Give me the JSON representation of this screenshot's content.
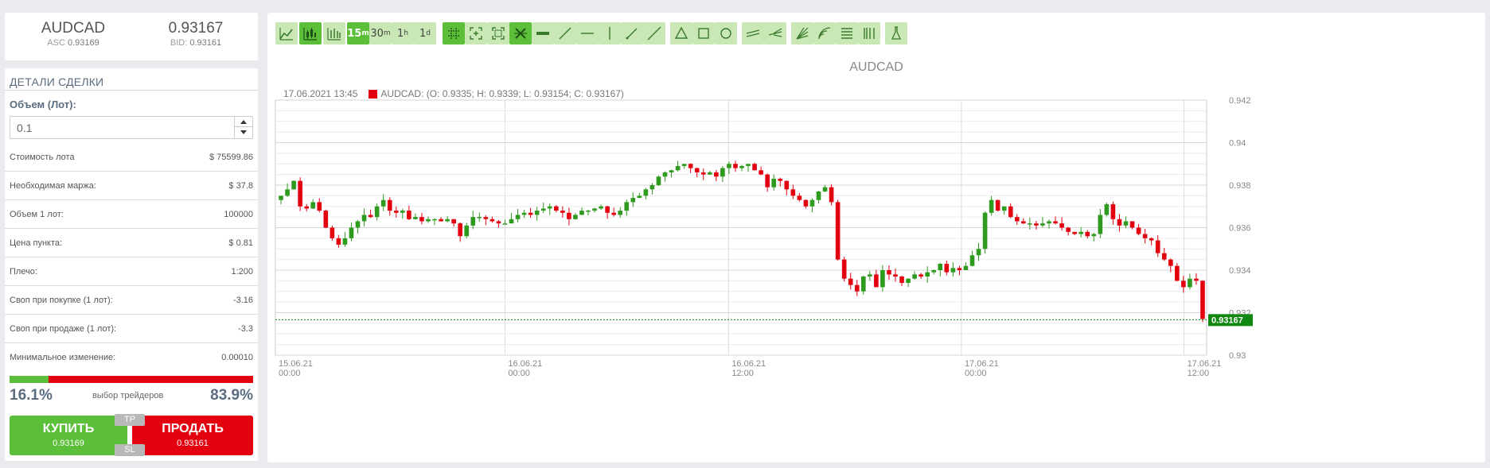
{
  "quote": {
    "symbol": "AUDCAD",
    "ask_label": "ASC",
    "ask": "0.93169",
    "price": "0.93167",
    "bid_label": "BID:",
    "bid": "0.93161"
  },
  "deal": {
    "title": "ДЕТАЛИ СДЕЛКИ",
    "volume_label": "Объем (Лот):",
    "volume_value": "0.1",
    "rows": [
      {
        "label": "Стоимость лота",
        "value": "$ 75599.86"
      },
      {
        "label": "Необходимая маржа:",
        "value": "$ 37.8"
      },
      {
        "label": "Объем 1 лот:",
        "value": "100000"
      },
      {
        "label": "Цена пункта:",
        "value": "$ 0.81"
      },
      {
        "label": "Плечо:",
        "value": "1:200"
      },
      {
        "label": "Своп при покупке (1 лот):",
        "value": "-3.16"
      },
      {
        "label": "Своп при продаже (1 лот):",
        "value": "-3.3"
      },
      {
        "label": "Минимальное изменение:",
        "value": "0.00010"
      }
    ],
    "sentiment": {
      "buy_percent": "16.1%",
      "sell_percent": "83.9%",
      "label": "выбор трейдеров",
      "buy_fraction": 0.161
    },
    "buy": {
      "label": "КУПИТЬ",
      "price": "0.93169"
    },
    "sell": {
      "label": "ПРОДАТЬ",
      "price": "0.93161"
    },
    "tp_label": "TP",
    "sl_label": "SL"
  },
  "toolbar": {
    "timeframes": [
      "15",
      "30",
      "1",
      "1"
    ],
    "timeframe_suffixes": [
      "m",
      "m",
      "h",
      "d"
    ],
    "active_timeframe": "15m"
  },
  "chart": {
    "title": "AUDCAD",
    "ohlc_time": "17.06.2021 13:45",
    "ohlc_text": "AUDCAD: (O: 0.9335; H: 0.9339; L: 0.93154; C: 0.93167)",
    "current_price_label": "0.93167"
  },
  "colors": {
    "up": "#2e9a1e",
    "down": "#e3000f",
    "accent": "#5cbf3a",
    "price_tag": "#118811"
  },
  "chart_data": {
    "type": "candlestick",
    "title": "AUDCAD",
    "ylim": [
      0.93,
      0.942
    ],
    "y_ticks": [
      "0.942",
      "0.94",
      "0.938",
      "0.936",
      "0.934",
      "0.932",
      "0.93"
    ],
    "x_tick_labels": [
      {
        "date": "15.06.21",
        "time": "00:00"
      },
      {
        "date": "16.06.21",
        "time": "00:00"
      },
      {
        "date": "16.06.21",
        "time": "12:00"
      },
      {
        "date": "17.06.21",
        "time": "00:00"
      },
      {
        "date": "17.06.21",
        "time": "12:00"
      }
    ],
    "current_price": 0.93167,
    "close_path": [
      0.9375,
      0.9378,
      0.9382,
      0.937,
      0.9369,
      0.9372,
      0.9368,
      0.936,
      0.9355,
      0.9352,
      0.9355,
      0.936,
      0.9363,
      0.9366,
      0.9365,
      0.937,
      0.9373,
      0.9368,
      0.9367,
      0.9368,
      0.9364,
      0.9365,
      0.9363,
      0.9364,
      0.9364,
      0.9363,
      0.9364,
      0.9362,
      0.9356,
      0.9361,
      0.9365,
      0.9365,
      0.9364,
      0.9363,
      0.9362,
      0.9362,
      0.9364,
      0.9366,
      0.9367,
      0.9366,
      0.9368,
      0.9369,
      0.937,
      0.9368,
      0.9367,
      0.9364,
      0.9366,
      0.9368,
      0.9368,
      0.9369,
      0.937,
      0.9367,
      0.9366,
      0.9368,
      0.9372,
      0.9374,
      0.9375,
      0.9378,
      0.938,
      0.9384,
      0.9386,
      0.9387,
      0.9389,
      0.939,
      0.9388,
      0.9386,
      0.9385,
      0.9386,
      0.9384,
      0.9388,
      0.939,
      0.9388,
      0.9389,
      0.939,
      0.9387,
      0.9385,
      0.9379,
      0.9383,
      0.9382,
      0.9378,
      0.9375,
      0.9373,
      0.937,
      0.9373,
      0.9377,
      0.9379,
      0.9372,
      0.9345,
      0.9336,
      0.9333,
      0.933,
      0.9337,
      0.9338,
      0.9332,
      0.934,
      0.9338,
      0.9337,
      0.9334,
      0.9336,
      0.9338,
      0.9337,
      0.9339,
      0.934,
      0.9343,
      0.9339,
      0.9341,
      0.934,
      0.9342,
      0.9347,
      0.935,
      0.9367,
      0.9373,
      0.9368,
      0.937,
      0.9365,
      0.9363,
      0.9362,
      0.9362,
      0.9361,
      0.9362,
      0.9363,
      0.9362,
      0.936,
      0.9358,
      0.9357,
      0.9358,
      0.9356,
      0.9357,
      0.9366,
      0.9371,
      0.9364,
      0.9361,
      0.9363,
      0.936,
      0.9357,
      0.9355,
      0.9354,
      0.9348,
      0.9345,
      0.9342,
      0.9335,
      0.9332,
      0.9336,
      0.9335,
      0.9317
    ]
  }
}
